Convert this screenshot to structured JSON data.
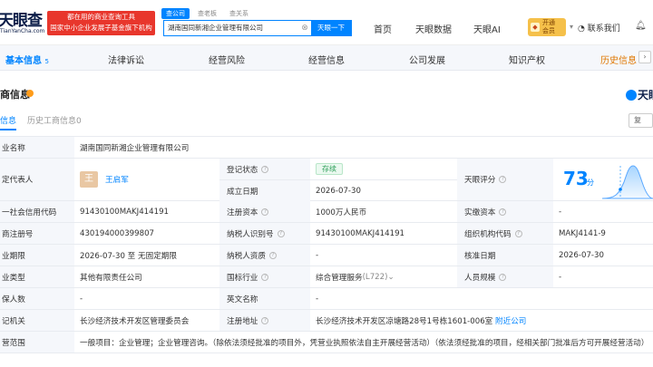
{
  "header": {
    "logo_main": "天眼查",
    "logo_sub": "TianYanCha.com",
    "slogan_line1": "都在用的商业查询工具",
    "slogan_line2": "国家中小企业发展子基金旗下机构",
    "search_tabs": [
      "查公司",
      "查老板",
      "查关系"
    ],
    "search_value": "湖南国同新湘企业管理有限公司",
    "search_button": "天眼一下",
    "nav": [
      "首页",
      "天眼数据",
      "天眼AI"
    ],
    "vip_line1": "开通",
    "vip_line2": "会员",
    "contact": "联系我们"
  },
  "tabs": [
    {
      "label": "基本信息",
      "count": "5"
    },
    {
      "label": "法律诉讼",
      "count": ""
    },
    {
      "label": "经营风险",
      "count": ""
    },
    {
      "label": "经营信息",
      "count": ""
    },
    {
      "label": "公司发展",
      "count": ""
    },
    {
      "label": "知识产权",
      "count": ""
    },
    {
      "label": "历史信息",
      "count": "5"
    }
  ],
  "section": {
    "title": "商信息",
    "brand": "天眼",
    "subtabs": [
      "信息",
      "历史工商信息0"
    ],
    "copy": "复"
  },
  "rows": {
    "r1": {
      "label": "业名称",
      "value": "湖南国同新湘企业管理有限公司"
    },
    "r2": {
      "label": "定代表人",
      "avatar": "王",
      "value": "王启军",
      "status_label": "登记状态",
      "status_value": "存续",
      "score_label": "天眼评分"
    },
    "r3": {
      "founded_label": "成立日期",
      "founded_value": "2026-07-30"
    },
    "r4": {
      "label": "一社会信用代码",
      "value": "91430100MAKJ414191",
      "l2": "注册资本",
      "v2": "1000万人民币",
      "l3": "实缴资本",
      "v3": "-"
    },
    "r5": {
      "label": "商注册号",
      "value": "430194000399807",
      "l2": "纳税人识别号",
      "v2": "91430100MAKJ414191",
      "l3": "组织机构代码",
      "v3": "MAKJ4141-9"
    },
    "r6": {
      "label": "业期限",
      "value": "2026-07-30 至 无固定期限",
      "l2": "纳税人资质",
      "v2": "-",
      "l3": "核准日期",
      "v3": "2026-07-30"
    },
    "r7": {
      "label": "业类型",
      "value": "其他有限责任公司",
      "l2": "国标行业",
      "v2": "综合管理服务",
      "v2b": "(L722)",
      "l3": "人员规模",
      "v3": "-"
    },
    "r8": {
      "label": "保人数",
      "value": "-",
      "l2": "英文名称",
      "v2": "-"
    },
    "r9": {
      "label": "记机关",
      "value": "长沙经济技术开发区管理委员会",
      "l2": "注册地址",
      "v2": "长沙经济技术开发区凉塘路28号1号栋1601-006室",
      "v2link": "附近公司"
    },
    "r10": {
      "label": "营范围",
      "value": "一般项目：企业管理；企业管理咨询。（除依法须经批准的项目外，凭营业执照依法自主开展经营活动）（依法须经批准的项目，经相关部门批准后方可开展经营活动）"
    }
  },
  "score": {
    "value": "73",
    "unit": "分"
  },
  "colors": {
    "accent": "#0084ff",
    "slogan_bg": "#e8362c",
    "vip": "#f5c04a",
    "status_green": "#2f9f5a"
  }
}
